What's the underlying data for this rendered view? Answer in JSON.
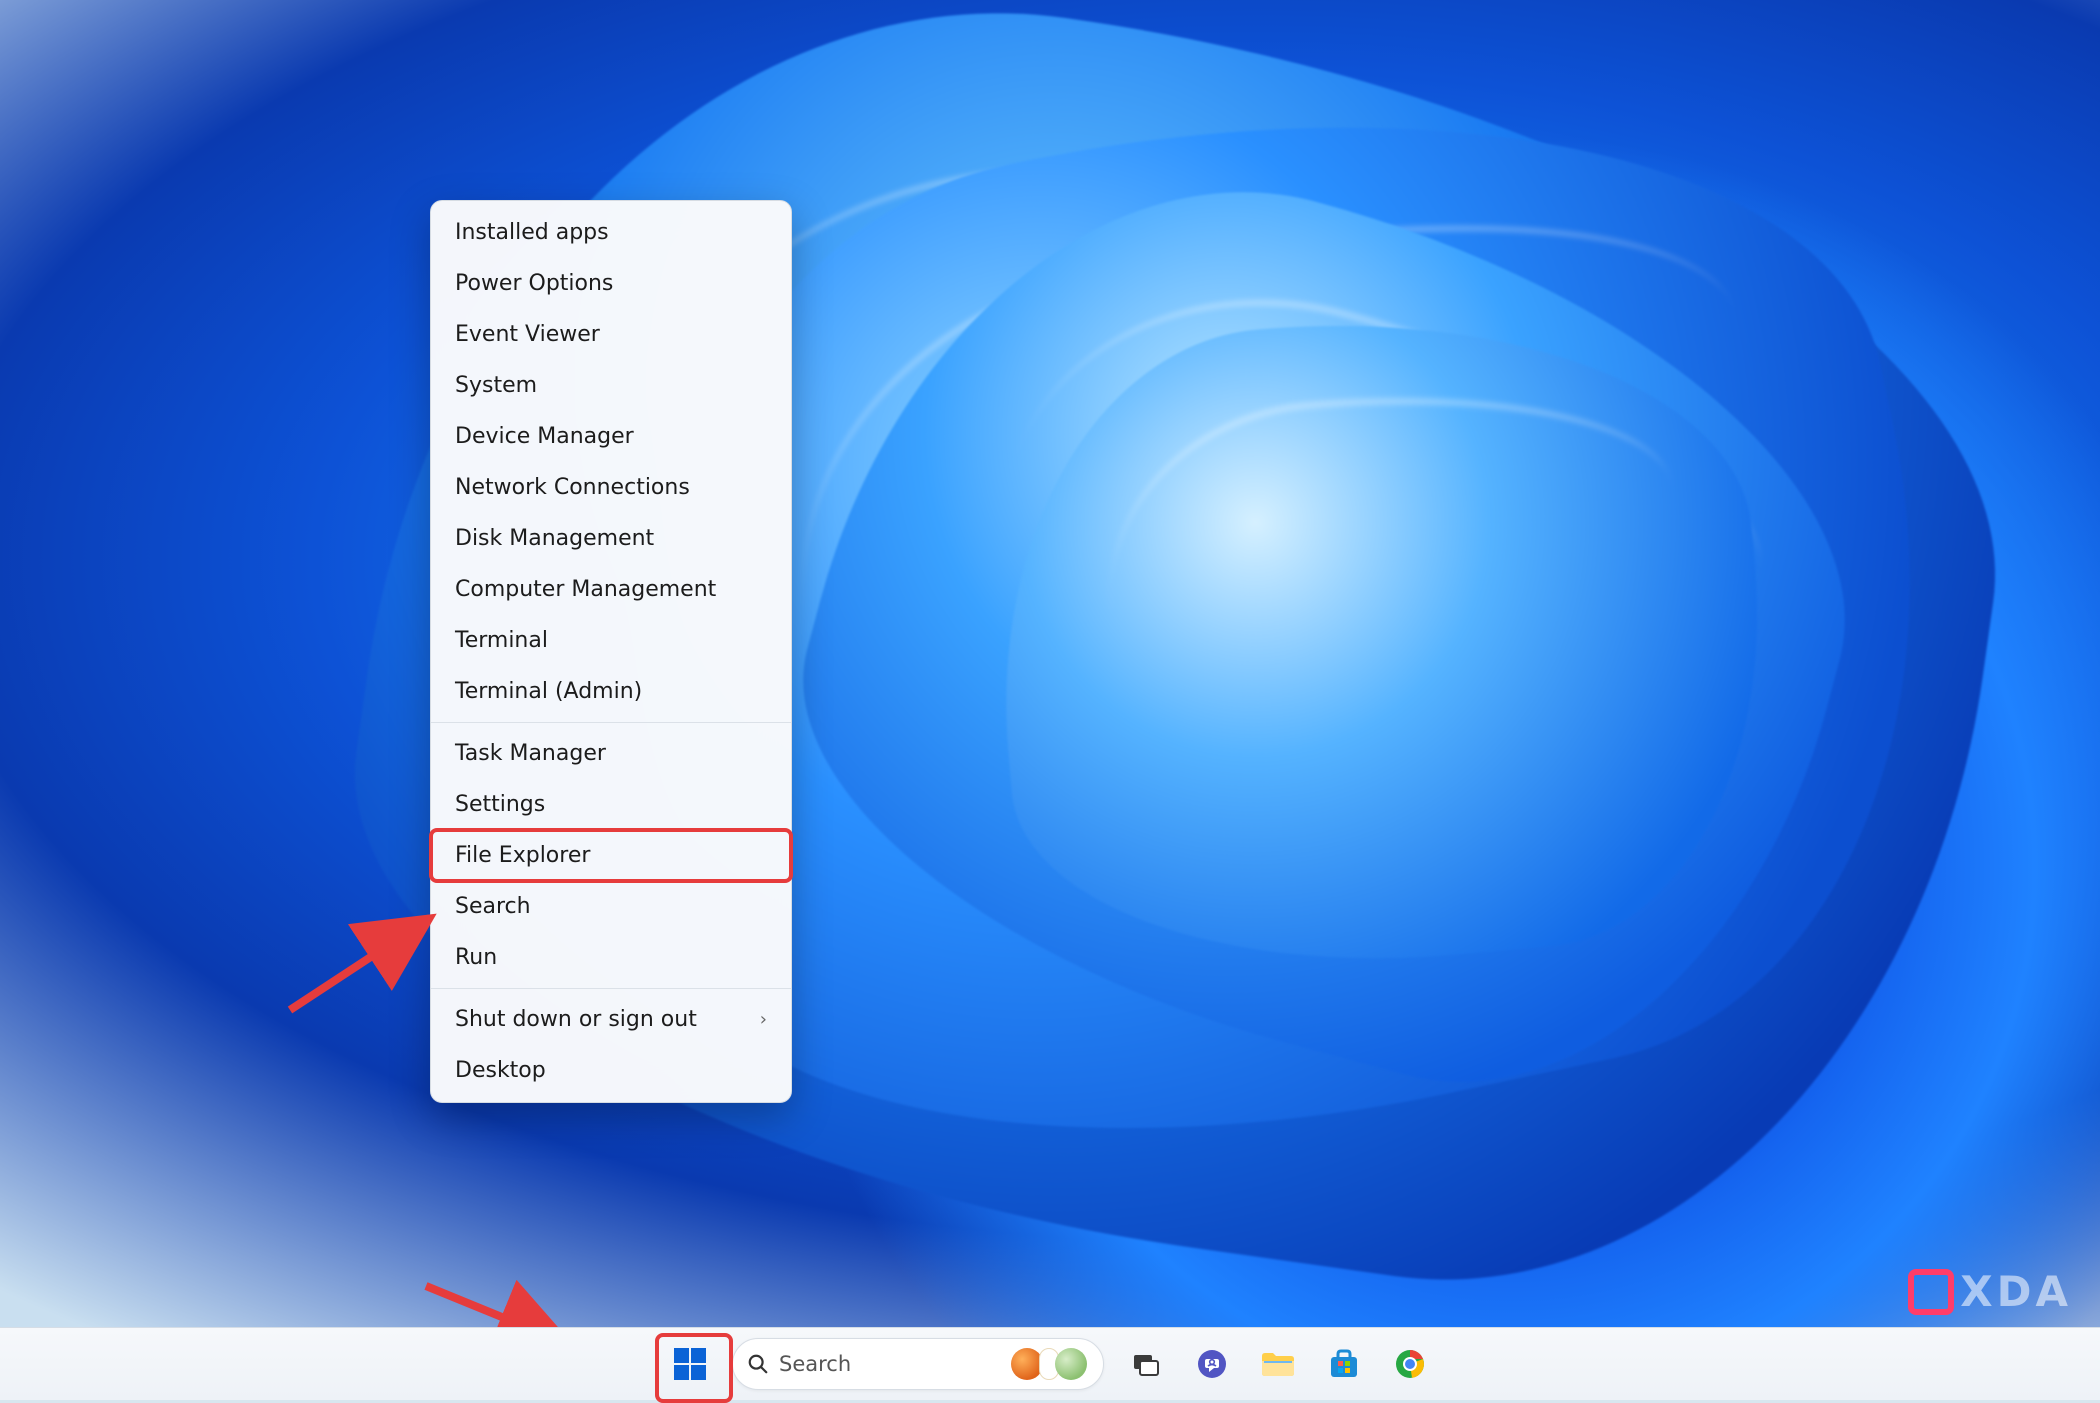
{
  "winx_menu": {
    "groups": [
      [
        "Installed apps",
        "Power Options",
        "Event Viewer",
        "System",
        "Device Manager",
        "Network Connections",
        "Disk Management",
        "Computer Management",
        "Terminal",
        "Terminal (Admin)"
      ],
      [
        "Task Manager",
        "Settings",
        "File Explorer",
        "Search",
        "Run"
      ],
      [
        "Shut down or sign out",
        "Desktop"
      ]
    ],
    "submenu_items": [
      "Shut down or sign out"
    ],
    "highlighted": "File Explorer"
  },
  "taskbar": {
    "search_placeholder": "Search",
    "icons": [
      {
        "name": "start-button",
        "title": "Start"
      },
      {
        "name": "search-box",
        "title": "Search"
      },
      {
        "name": "task-view-button",
        "title": "Task View"
      },
      {
        "name": "chat-button",
        "title": "Chat"
      },
      {
        "name": "file-explorer-button",
        "title": "File Explorer"
      },
      {
        "name": "microsoft-store-button",
        "title": "Microsoft Store"
      },
      {
        "name": "chrome-button",
        "title": "Google Chrome"
      }
    ]
  },
  "watermark": {
    "text": "XDA"
  },
  "annotation": {
    "highlight_targets": [
      "File Explorer menu item",
      "Start button"
    ],
    "arrow_color": "#e63c3c"
  }
}
